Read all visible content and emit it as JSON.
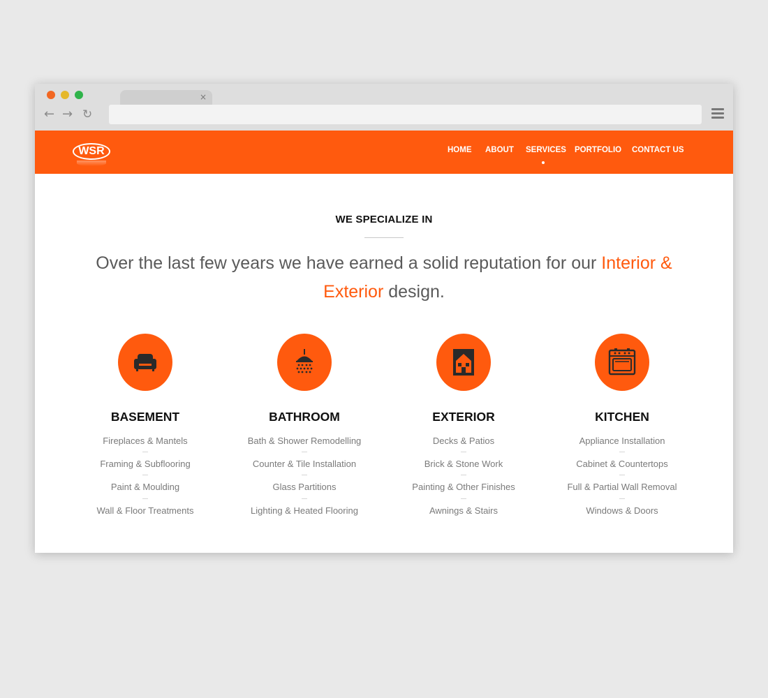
{
  "colors": {
    "accent": "#ff5a0e",
    "background": "#e9e9e9"
  },
  "browser": {
    "tab_close": "×",
    "back_icon": "←",
    "forward_icon": "→",
    "reload_icon": "↻"
  },
  "header": {
    "logo_text": "WSR",
    "nav": [
      "HOME",
      "ABOUT",
      "SERVICES",
      "PORTFOLIO",
      "CONTACT US"
    ],
    "active_item": "SERVICES"
  },
  "main": {
    "section_title": "WE SPECIALIZE IN",
    "lead_before": "Over the last few years we have earned a solid reputation for our ",
    "lead_highlight": "Interior & Exterior",
    "lead_after": " design.",
    "services": [
      {
        "title": "BASEMENT",
        "icon": "armchair-icon",
        "items": [
          "Fireplaces & Mantels",
          "Framing & Subflooring",
          "Paint & Moulding",
          "Wall & Floor Treatments"
        ]
      },
      {
        "title": "BATHROOM",
        "icon": "shower-icon",
        "items": [
          "Bath & Shower Remodelling",
          "Counter & Tile Installation",
          "Glass Partitions",
          "Lighting & Heated Flooring"
        ]
      },
      {
        "title": "EXTERIOR",
        "icon": "house-icon",
        "items": [
          "Decks & Patios",
          "Brick & Stone Work",
          "Painting & Other Finishes",
          "Awnings & Stairs"
        ]
      },
      {
        "title": "KITCHEN",
        "icon": "oven-icon",
        "items": [
          "Appliance Installation",
          "Cabinet & Countertops",
          "Full & Partial Wall Removal",
          "Windows & Doors"
        ]
      }
    ]
  }
}
